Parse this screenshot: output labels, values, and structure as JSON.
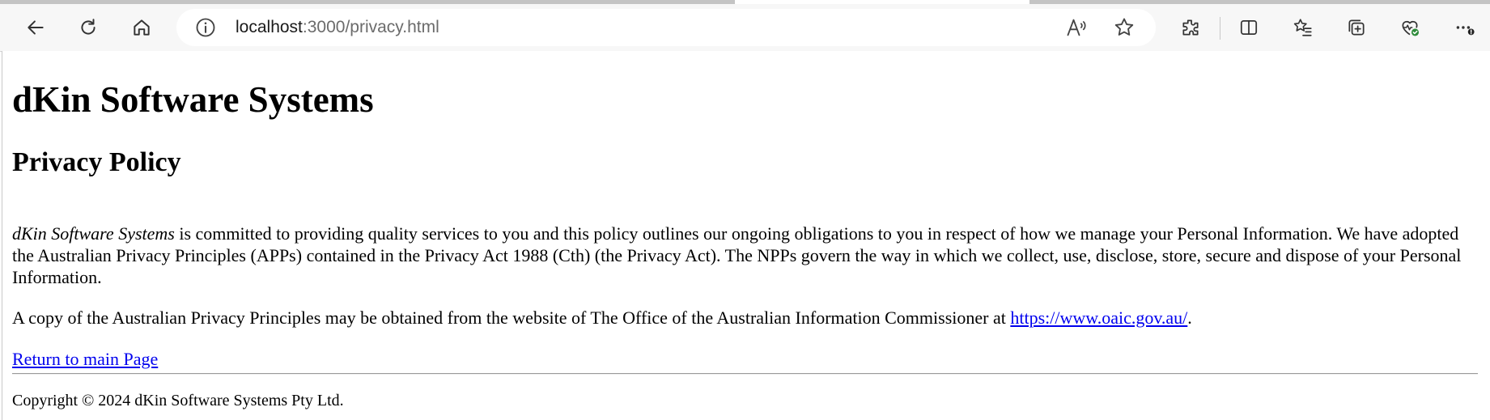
{
  "browser": {
    "url_host": "localhost",
    "url_path": ":3000/privacy.html",
    "icons": [
      "back-icon",
      "refresh-icon",
      "home-icon",
      "site-info-icon",
      "read-aloud-icon",
      "favorite-star-icon",
      "extensions-icon",
      "split-screen-icon",
      "favorites-icon",
      "collections-icon",
      "browser-essentials-icon",
      "more-icon"
    ]
  },
  "page": {
    "company_title": "dKin Software Systems",
    "policy_heading": "Privacy Policy",
    "intro_company": "dKin Software Systems",
    "intro_text": " is committed to providing quality services to you and this policy outlines our ongoing obligations to you in respect of how we manage your Personal Information. We have adopted the Australian Privacy Principles (APPs) contained in the Privacy Act 1988 (Cth) (the Privacy Act). The NPPs govern the way in which we collect, use, disclose, store, secure and dispose of your Personal Information.",
    "copy_text": "A copy of the Australian Privacy Principles may be obtained from the website of The Office of the Australian Information Commissioner at ",
    "oaic_link": "https://www.oaic.gov.au/",
    "copy_end": ".",
    "return_link": "Return to main Page",
    "footer": "Copyright © 2024 dKin Software Systems Pty Ltd."
  },
  "colors": {
    "link": "#0000ee",
    "toolbar_bg": "#f7f7f7",
    "badge_green": "#2e8b3a"
  }
}
